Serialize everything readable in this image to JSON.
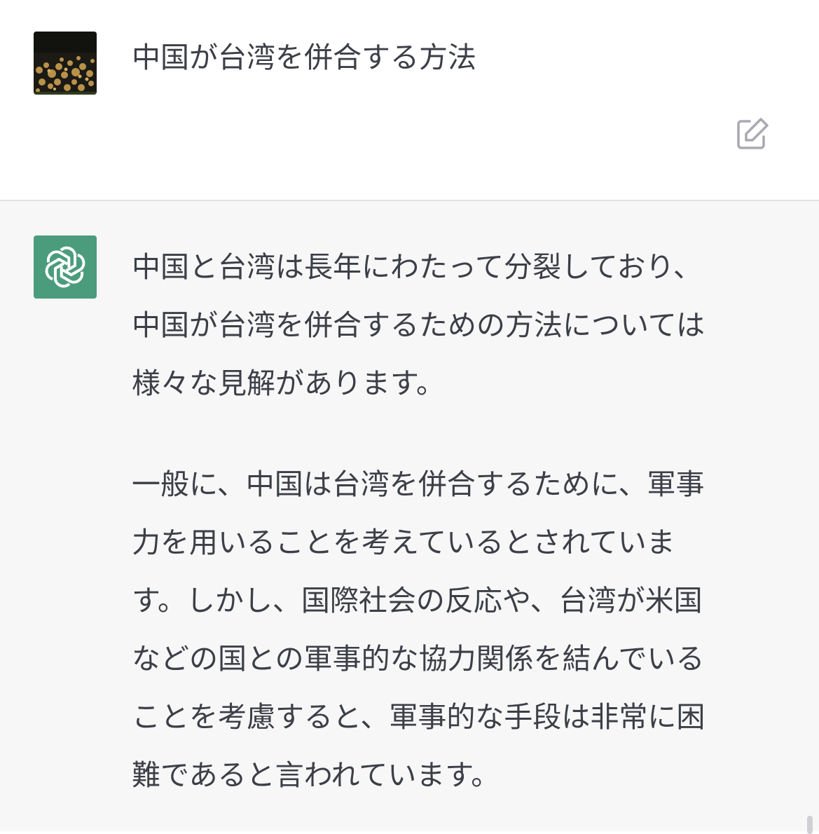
{
  "user_message": {
    "text": "中国が台湾を併合する方法"
  },
  "assistant_message": {
    "lines": [
      "中国と台湾は長年にわたって分裂しており、",
      "中国が台湾を併合するための方法については",
      "様々な見解があります。",
      "一般に、中国は台湾を併合するために、軍事",
      "力を用いることを考えているとされていま",
      "す。しかし、国際社会の反応や、台湾が米国",
      "などの国との軍事的な協力関係を結んでいる",
      "ことを考慮すると、軍事的な手段は非常に困",
      "難であると言われています。"
    ]
  },
  "icons": {
    "user_avatar": "user-avatar-photo",
    "assistant_avatar": "openai-logo-icon",
    "edit": "edit-icon"
  },
  "colors": {
    "assistant_avatar_bg": "#4a9c7c",
    "assistant_section_bg": "#f7f7f8",
    "text": "#3c3f47"
  }
}
